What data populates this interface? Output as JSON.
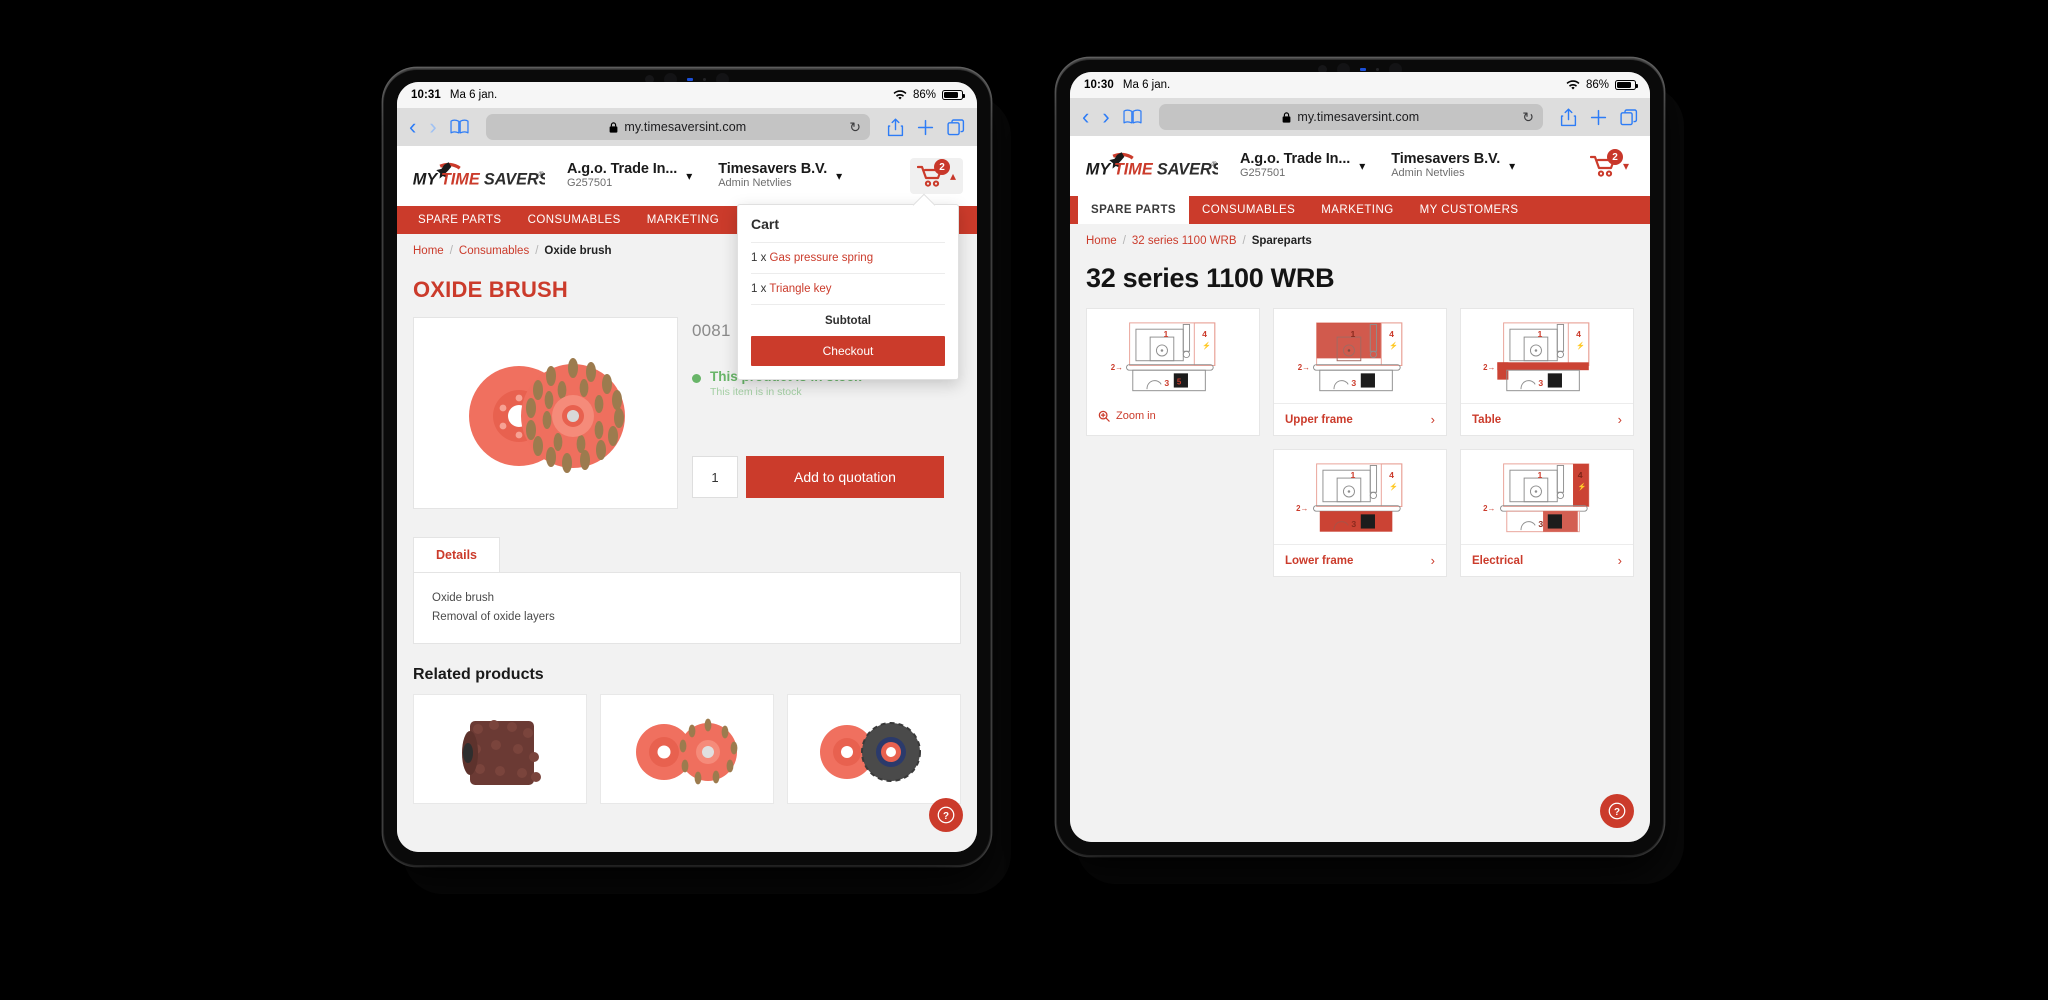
{
  "statusbar": {
    "left_time": "10:31",
    "right_time": "10:30",
    "date": "Ma 6 jan.",
    "battery": "86%"
  },
  "browser": {
    "url": "my.timesaversint.com",
    "back_icon": "chevron-left-icon",
    "forward_icon": "chevron-right-icon",
    "bookmarks_icon": "book-icon",
    "lock_icon": "lock-icon",
    "reload_icon": "reload-icon",
    "share_icon": "share-icon",
    "newtab_icon": "plus-icon",
    "tabs_icon": "tabs-icon"
  },
  "header": {
    "logo_text": "MY TIMESAVERS",
    "account": {
      "name": "A.g.o. Trade In...",
      "code": "G257501"
    },
    "user": {
      "name": "Timesavers B.V.",
      "role": "Admin Netvlies"
    },
    "cart_count": "2",
    "cart_icon": "cart-icon",
    "chevron_down_icon": "chevron-down-icon",
    "chevron_up_icon": "chevron-up-icon"
  },
  "nav": {
    "items": [
      {
        "label": "SPARE PARTS"
      },
      {
        "label": "CONSUMABLES"
      },
      {
        "label": "MARKETING"
      },
      {
        "label": "MY CUSTOMERS"
      }
    ],
    "left_active_index": -1,
    "right_active_index": 0
  },
  "cart_popup": {
    "title": "Cart",
    "lines": [
      {
        "qty": "1 x",
        "name": "Gas pressure spring"
      },
      {
        "qty": "1 x",
        "name": "Triangle key"
      }
    ],
    "subtotal_label": "Subtotal",
    "checkout_label": "Checkout"
  },
  "left_page": {
    "breadcrumb": [
      {
        "label": "Home",
        "link": true
      },
      {
        "label": "Consumables",
        "link": true
      },
      {
        "label": "Oxide brush",
        "link": false
      }
    ],
    "title": "OXIDE BRUSH",
    "sku": "0081",
    "stock_main": "This product is in stock",
    "stock_sub": "This item is in stock",
    "qty_value": "1",
    "add_button": "Add to quotation",
    "tab_label": "Details",
    "detail_line1": "Oxide brush",
    "detail_line2": "Removal of oxide layers",
    "related_title": "Related products",
    "help_icon": "help-circle-icon"
  },
  "right_page": {
    "breadcrumb": [
      {
        "label": "Home",
        "link": true
      },
      {
        "label": "32 series 1100 WRB",
        "link": true
      },
      {
        "label": "Spareparts",
        "link": false
      }
    ],
    "title": "32 series 1100 WRB",
    "zoom_in_label": "Zoom in",
    "zoom_in_icon": "magnifier-plus-icon",
    "cards": [
      {
        "label": "Upper frame",
        "highlight": "upper"
      },
      {
        "label": "Table",
        "highlight": "table"
      },
      {
        "label": "Lower frame",
        "highlight": "lower"
      },
      {
        "label": "Electrical",
        "highlight": "electrical"
      }
    ],
    "arrow_icon": "chevron-right-icon",
    "help_icon": "help-circle-icon"
  },
  "colors": {
    "brand_red": "#cb3b2b",
    "stock_green": "#68b568",
    "nav_red": "#cb3b2b",
    "page_bg": "#f2f2f2"
  }
}
